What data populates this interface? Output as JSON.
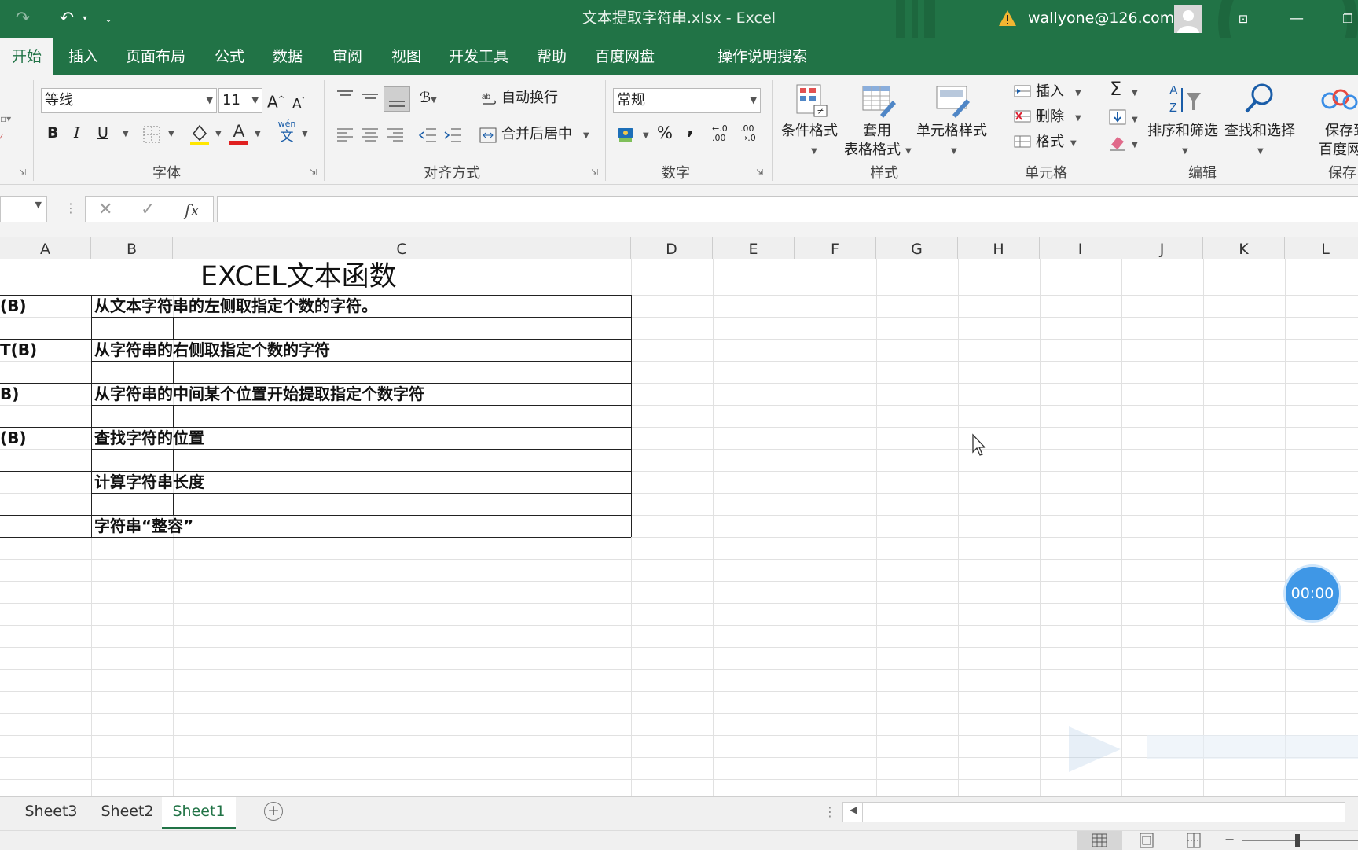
{
  "window": {
    "title": "文本提取字符串.xlsx  -  Excel",
    "account": "wallyone@126.com"
  },
  "tabs": [
    {
      "label": "开始",
      "active": true
    },
    {
      "label": "插入"
    },
    {
      "label": "页面布局"
    },
    {
      "label": "公式"
    },
    {
      "label": "数据"
    },
    {
      "label": "审阅"
    },
    {
      "label": "视图"
    },
    {
      "label": "开发工具"
    },
    {
      "label": "帮助"
    },
    {
      "label": "百度网盘"
    },
    {
      "label": "操作说明搜索"
    }
  ],
  "ribbon": {
    "font": {
      "name": "等线",
      "size": "11",
      "label": "字体",
      "bold": "B",
      "italic": "I",
      "underline": "U",
      "phonetic_top": "wén",
      "phonetic_bottom": "文"
    },
    "alignment": {
      "wrap_text": "自动换行",
      "merge_center": "合并后居中",
      "label": "对齐方式"
    },
    "number": {
      "format": "常规",
      "percent": "%",
      "comma": ",",
      "label": "数字"
    },
    "styles": {
      "conditional": "条件格式",
      "table_line1": "套用",
      "table_line2": "表格格式",
      "cell_styles": "单元格样式",
      "label": "样式"
    },
    "cells": {
      "insert": "插入",
      "delete": "删除",
      "format": "格式",
      "label": "单元格"
    },
    "editing": {
      "sort_filter": "排序和筛选",
      "find_select": "查找和选择",
      "label": "编辑"
    },
    "save": {
      "line1": "保存到",
      "line2": "百度网盘",
      "label": "保存"
    }
  },
  "formula_bar": {
    "fx": "fx",
    "cancel": "✕",
    "enter": "✓"
  },
  "columns": [
    "A",
    "B",
    "C",
    "D",
    "E",
    "F",
    "G",
    "H",
    "I",
    "J",
    "K",
    "L"
  ],
  "sheet": {
    "title": "EXCEL文本函数",
    "rows": [
      {
        "a": "(B)",
        "desc": " 从文本字符串的左侧取指定个数的字符。"
      },
      {
        "a": "T(B)",
        "desc": "从字符串的右侧取指定个数的字符"
      },
      {
        "a": "B)",
        "desc": "从字符串的中间某个位置开始提取指定个数字符"
      },
      {
        "a": "(B)",
        "desc": "查找字符的位置"
      },
      {
        "a": "",
        "desc": "计算字符串长度"
      },
      {
        "a": "",
        "desc": "字符串“整容”"
      }
    ]
  },
  "timer": "00:00",
  "sheet_tabs": [
    {
      "label": "Sheet3"
    },
    {
      "label": "Sheet2"
    },
    {
      "label": "Sheet1",
      "active": true
    }
  ],
  "colors": {
    "excel_green": "#217346",
    "ribbon_bg": "#f3f3f3",
    "timer_blue": "#3f97e6"
  }
}
